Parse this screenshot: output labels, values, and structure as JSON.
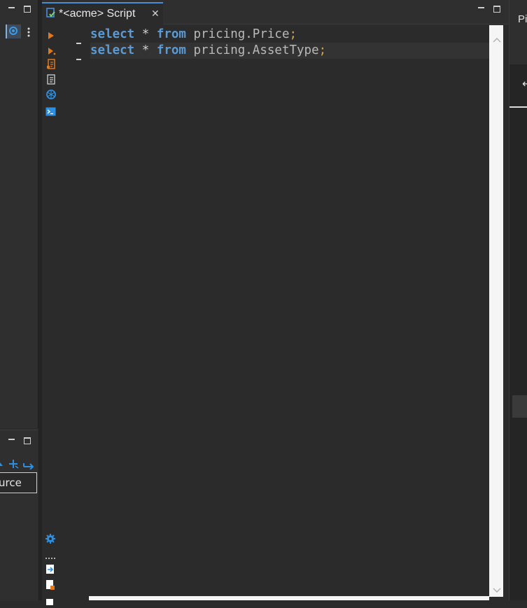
{
  "left_panel": {
    "bottom": {
      "tab_label": "urce"
    }
  },
  "editor": {
    "tab": {
      "title": "*<acme> Script",
      "close_symbol": "✕"
    },
    "lines": [
      {
        "kw1": "select",
        "star": " * ",
        "kw2": "from",
        "ident": " pricing.Price",
        "semi": ";"
      },
      {
        "kw1": "select",
        "star": " * ",
        "kw2": "from",
        "ident": " pricing.AssetType",
        "semi": ";"
      }
    ],
    "gutter_icons": [
      "execute-statement-icon",
      "execute-script-icon",
      "explain-plan-icon",
      "load-plan-icon",
      "ai-assistant-icon",
      "terminal-icon"
    ],
    "bottom_icons": [
      "settings-icon",
      "more-icon",
      "export-icon",
      "import-icon"
    ]
  },
  "right_panel": {
    "label": "Pi",
    "arrow": "←"
  },
  "colors": {
    "keyword": "#5b9bd5",
    "punct": "#d4a44a",
    "tab_accent": "#4a8fd6",
    "icon_orange": "#e0781e",
    "icon_blue": "#2e8fe0"
  }
}
